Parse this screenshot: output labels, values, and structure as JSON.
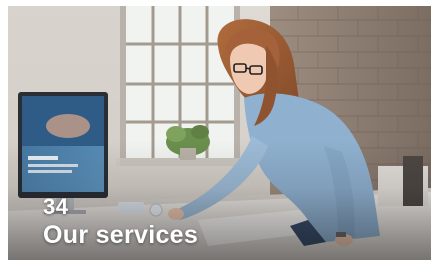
{
  "card": {
    "number": "34",
    "title": "Our services"
  },
  "scene": {
    "subject": "woman-at-desk-photo",
    "icons": [
      "monitor-icon"
    ],
    "colors": {
      "wall": "#d9d5cf",
      "brick": "#8f7e72",
      "window": "#eef1ee",
      "hair": "#9a5a34",
      "shirt": "#8fb0cf",
      "desk": "#e7e4df"
    }
  }
}
